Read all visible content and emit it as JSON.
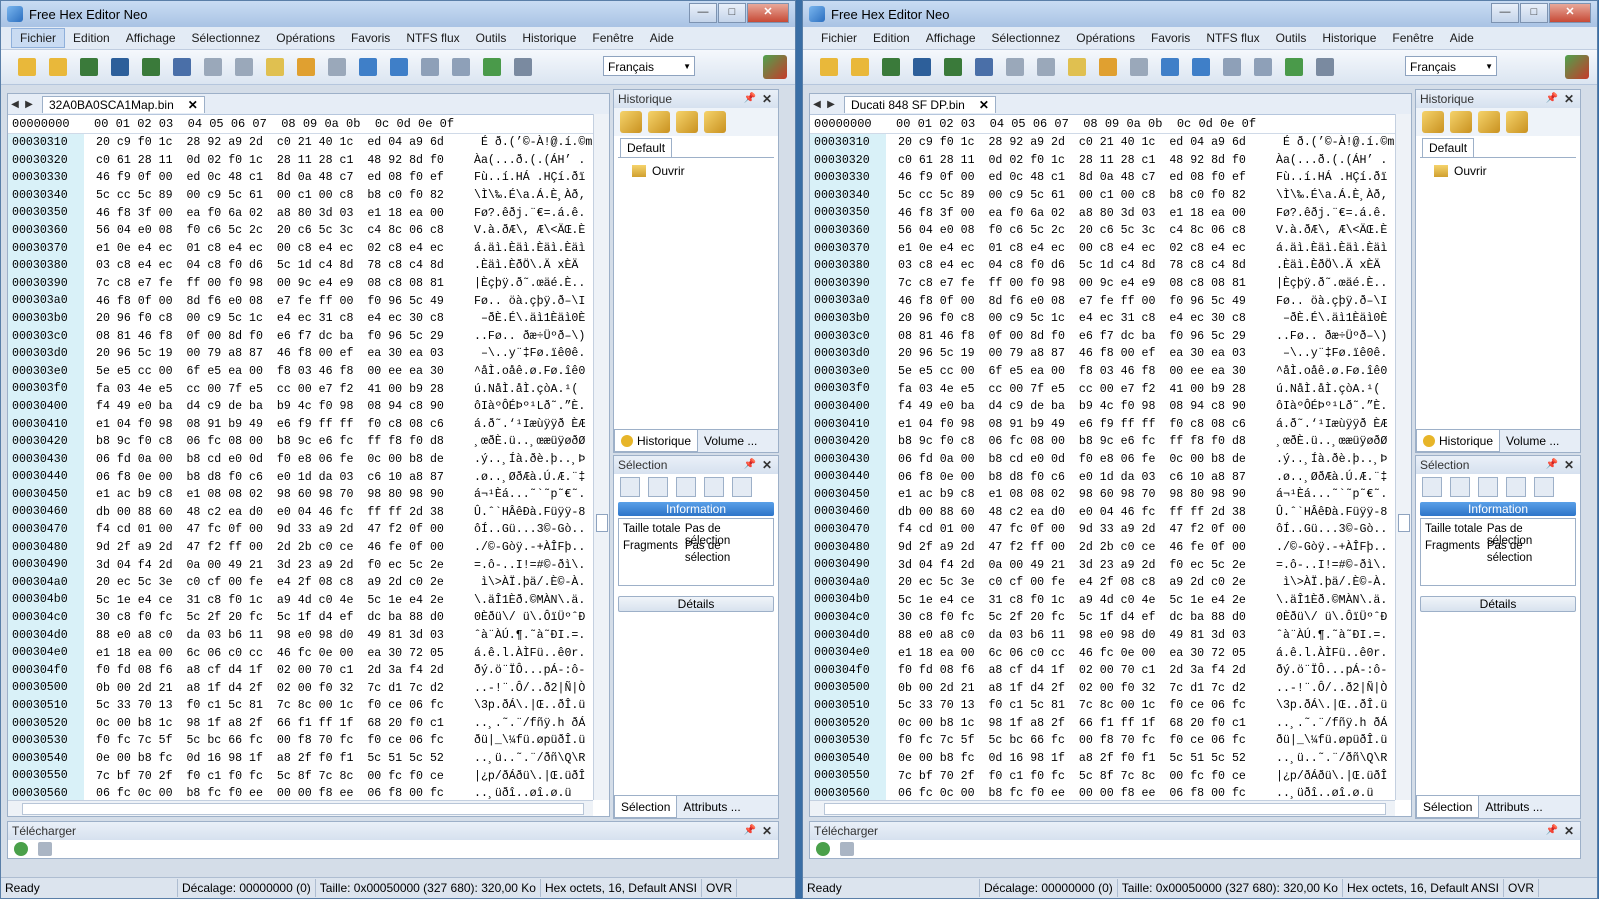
{
  "app_title": "Free Hex Editor Neo",
  "menu": [
    "Fichier",
    "Edition",
    "Affichage",
    "Sélectionnez",
    "Opérations",
    "Favoris",
    "NTFS flux",
    "Outils",
    "Historique",
    "Fenêtre",
    "Aide"
  ],
  "language": "Français",
  "hex_header": {
    "offset": "00000000",
    "columns": "00 01 02 03  04 05 06 07  08 09 0a 0b  0c 0d 0e 0f"
  },
  "rows": [
    {
      "o": "00030310",
      "h": "20 c9 f0 1c  28 92 a9 2d  c0 21 40 1c  ed 04 a9 6d",
      "a": " É ð.(’©-À!@.í.©m"
    },
    {
      "o": "00030320",
      "h": "c0 61 28 11  0d 02 f0 1c  28 11 28 c1  48 92 8d f0",
      "a": "Àa(...ð.(.(ÁH’ ."
    },
    {
      "o": "00030330",
      "h": "46 f9 0f 00  ed 0c 48 c1  8d 0a 48 c7  ed 08 f0 ef",
      "a": "Fù..í.HÁ .HÇí.ðï"
    },
    {
      "o": "00030340",
      "h": "5c cc 5c 89  00 c9 5c 61  00 c1 00 c8  b8 c0 f0 82",
      "a": "\\Ì\\‰.É\\a.Á.È¸Àð‚"
    },
    {
      "o": "00030350",
      "h": "46 f8 3f 00  ea f0 6a 02  a8 80 3d 03  e1 18 ea 00",
      "a": "Fø?.êðj.¨€=.á.ê."
    },
    {
      "o": "00030360",
      "h": "56 04 e0 08  f0 c6 5c 2c  20 c6 5c 3c  c4 8c 06 c8",
      "a": "V.à.ðÆ\\, Æ\\<ÄŒ.È"
    },
    {
      "o": "00030370",
      "h": "e1 0e e4 ec  01 c8 e4 ec  00 c8 e4 ec  02 c8 e4 ec",
      "a": "á.äì.Èäì.Èäì.Èäì"
    },
    {
      "o": "00030380",
      "h": "03 c8 e4 ec  04 c8 f0 d6  5c 1d c4 8d  78 c8 c4 8d",
      "a": ".Èäì.ÈðÖ\\.Ä xÈÄ"
    },
    {
      "o": "00030390",
      "h": "7c c8 e7 fe  ff 00 f0 98  00 9c e4 e9  08 c8 08 81",
      "a": "|Èçþÿ.ð˜.œäé.È.."
    },
    {
      "o": "000303a0",
      "h": "46 f8 0f 00  8d f6 e0 08  e7 fe ff 00  f0 96 5c 49",
      "a": "Fø.. öà.çþÿ.ð–\\I"
    },
    {
      "o": "000303b0",
      "h": "20 96 f0 c8  00 c9 5c 1c  e4 ec 31 c8  e4 ec 30 c8",
      "a": " –ðÈ.É\\.äì1Èäì0È"
    },
    {
      "o": "000303c0",
      "h": "08 81 46 f8  0f 00 8d f0  e6 f7 dc ba  f0 96 5c 29",
      "a": "..Fø.. ðæ÷Üºð–\\)"
    },
    {
      "o": "000303d0",
      "h": "20 96 5c 19  00 79 a8 87  46 f8 00 ef  ea 30 ea 03",
      "a": " –\\..y¨‡Fø.ïê0ê."
    },
    {
      "o": "000303e0",
      "h": "5e e5 cc 00  6f e5 ea 00  f8 03 46 f8  00 ee ea 30",
      "a": "^åÌ.oåê.ø.Fø.îê0"
    },
    {
      "o": "000303f0",
      "h": "fa 03 4e e5  cc 00 7f e5  cc 00 e7 f2  41 00 b9 28",
      "a": "ú.NåÌ.åÌ.çòA.¹("
    },
    {
      "o": "00030400",
      "h": "f4 49 e0 ba  d4 c9 de ba  b9 4c f0 98  08 94 c8 90",
      "a": "ôIàºÔÉÞº¹Lð˜.”È."
    },
    {
      "o": "00030410",
      "h": "e1 04 f0 98  08 91 b9 49  e6 f9 ff ff  f0 c8 08 c6",
      "a": "á.ð˜.‘¹Iæùÿÿð ÈÆ"
    },
    {
      "o": "00030420",
      "h": "b8 9c f0 c8  06 fc 08 00  b8 9c e6 fc  ff f8 f0 d8",
      "a": "¸œðÈ.ü..¸œæüÿøðØ"
    },
    {
      "o": "00030430",
      "h": "06 fd 0a 00  b8 cd e0 0d  f0 e8 06 fe  0c 00 b8 de",
      "a": ".ý..¸Íà.ðè.þ..¸Þ"
    },
    {
      "o": "00030440",
      "h": "06 f8 0e 00  b8 d8 f0 c6  e0 1d da 03  c6 10 a8 87",
      "a": ".ø..¸ØðÆà.Ú.Æ.¨‡"
    },
    {
      "o": "00030450",
      "h": "e1 ac b9 c8  e1 08 08 02  98 60 98 70  98 80 98 90",
      "a": "á¬¹Èá...˜`˜p˜€˜."
    },
    {
      "o": "00030460",
      "h": "db 00 88 60  48 c2 ea d0  e0 04 46 fc  ff ff 2d 38",
      "a": "Û.ˆ`HÂêÐà.Füÿÿ-8"
    },
    {
      "o": "00030470",
      "h": "f4 cd 01 00  47 fc 0f 00  9d 33 a9 2d  47 f2 0f 00",
      "a": "ôÍ..Gü...3©-Gò.."
    },
    {
      "o": "00030480",
      "h": "9d 2f a9 2d  47 f2 ff 00  2d 2b c0 ce  46 fe 0f 00",
      "a": "./©-Gòÿ.-+ÀÎFþ.."
    },
    {
      "o": "00030490",
      "h": "3d 04 f4 2d  0a 00 49 21  3d 23 a9 2d  f0 ec 5c 2e",
      "a": "=.ô-..I!=#©-ðì\\."
    },
    {
      "o": "000304a0",
      "h": "20 ec 5c 3e  c0 cf 00 fe  e4 2f 08 c8  a9 2d c0 2e",
      "a": " ì\\>ÀÏ.þä/.È©-À."
    },
    {
      "o": "000304b0",
      "h": "5c 1e e4 ce  31 c8 f0 1c  a9 4d c0 4e  5c 1e e4 2e",
      "a": "\\.äÎ1Èð.©MÀN\\.ä."
    },
    {
      "o": "000304c0",
      "h": "30 c8 f0 fc  5c 2f 20 fc  5c 1f d4 ef  dc ba 88 d0",
      "a": "0Èðü\\/ ü\\.ÔïÜºˆÐ"
    },
    {
      "o": "000304d0",
      "h": "88 e0 a8 c0  da 03 b6 11  98 e0 98 d0  49 81 3d 03",
      "a": "ˆà¨ÀÚ.¶.˜à˜ÐI.=."
    },
    {
      "o": "000304e0",
      "h": "e1 18 ea 00  6c 06 c0 cc  46 fc 0e 00  ea 30 72 05",
      "a": "á.ê.l.ÀÌFü..ê0r."
    },
    {
      "o": "000304f0",
      "h": "f0 fd 08 f6  a8 cf d4 1f  02 00 70 c1  2d 3a f4 2d",
      "a": "ðý.ö¨ÏÔ...pÁ-:ô-"
    },
    {
      "o": "00030500",
      "h": "0b 00 2d 21  a8 1f d4 2f  02 00 f0 32  7c d1 7c d2",
      "a": "..-!¨.Ô/..ð2|Ñ|Ò"
    },
    {
      "o": "00030510",
      "h": "5c 33 70 13  f0 c1 5c 81  7c 8c 00 1c  f0 ce 06 fc",
      "a": "\\3p.ðÁ\\.|Œ..ðÎ.ü"
    },
    {
      "o": "00030520",
      "h": "0c 00 b8 1c  98 1f a8 2f  66 f1 ff 1f  68 20 f0 c1",
      "a": "..¸.˜.¨/fñÿ.h ðÁ"
    },
    {
      "o": "00030530",
      "h": "f0 fc 7c 5f  5c bc 66 fc  00 f8 70 fc  f0 ce 06 fc",
      "a": "ðü|_\\¼fü.øpüðÎ.ü"
    },
    {
      "o": "00030540",
      "h": "0e 00 b8 fc  0d 16 98 1f  a8 2f f0 f1  5c 51 5c 52",
      "a": "..¸ü..˜.¨/ðñ\\Q\\R"
    },
    {
      "o": "00030550",
      "h": "7c bf 70 2f  f0 c1 f0 fc  5c 8f 7c 8c  00 fc f0 ce",
      "a": "|¿p/ðÁðü\\.|Œ.üðÎ"
    },
    {
      "o": "00030560",
      "h": "06 fc 0c 00  b8 fc f0 ee  00 00 f8 ee  06 f8 00 fc",
      "a": "..¸üðî..øî.ø.ü"
    }
  ],
  "left": {
    "file_tab": "32A0BA0SCA1Map.bin"
  },
  "right": {
    "file_tab": "Ducati 848 SF DP.bin"
  },
  "history": {
    "title": "Historique",
    "default_tab": "Default",
    "item": "Ouvrir",
    "tab_history": "Historique",
    "tab_volume": "Volume ..."
  },
  "selection": {
    "title": "Sélection",
    "info_button": "Information",
    "total_size_label": "Taille totale",
    "total_size_value": "Pas de sélection",
    "fragments_label": "Fragments",
    "fragments_value": "Pas de sélection",
    "details_button": "Détails",
    "tab_selection": "Sélection",
    "tab_attributes": "Attributs ..."
  },
  "download": {
    "title": "Télécharger"
  },
  "status": {
    "ready": "Ready",
    "offset": "Décalage: 00000000 (0)",
    "size": "Taille: 0x00050000 (327 680): 320,00 Ko",
    "mode": "Hex octets, 16, Default ANSI",
    "ovr": "OVR"
  }
}
